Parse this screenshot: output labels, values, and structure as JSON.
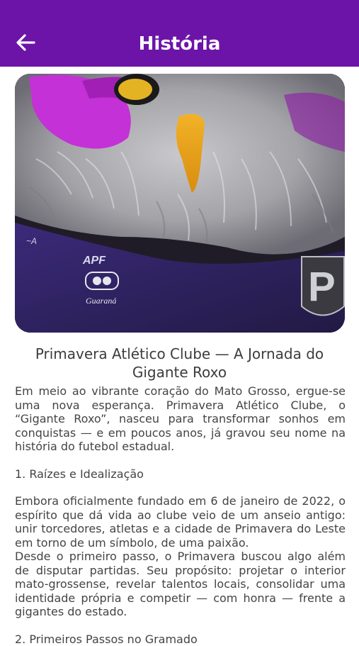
{
  "app_bar": {
    "title": "História",
    "background_color": "#6d14a8",
    "back_icon": "arrow-left-icon"
  },
  "hero_image": {
    "description_icon": "mascot-owl-image",
    "shirt_text": "Guaraná",
    "crest_letter": "P"
  },
  "article": {
    "heading": "Primavera Atlético Clube — A Jornada do Gigante Roxo",
    "intro": "Em meio ao vibrante coração do Mato Grosso, ergue-se uma nova esperança. Primavera Atlético Clube, o “Gigante Roxo”, nasceu para transformar sonhos em conquistas — e em poucos anos, já gravou seu nome na história do futebol estadual.",
    "section1_title": "1. Raízes e Idealização",
    "section1_p1": "Embora oficialmente fundado em 6 de janeiro de 2022, o espírito que dá vida ao clube veio de um anseio antigo: unir torcedores, atletas e a cidade de Primavera do Leste em torno de um símbolo, de uma paixão.",
    "section1_p2": "Desde o primeiro passo, o Primavera buscou algo além de disputar partidas. Seu propósito: projetar o interior mato-grossense, revelar talentos locais, consolidar uma identidade própria e competir — com honra — frente a gigantes do estado.",
    "section2_title": "2. Primeiros Passos no Gramado"
  }
}
